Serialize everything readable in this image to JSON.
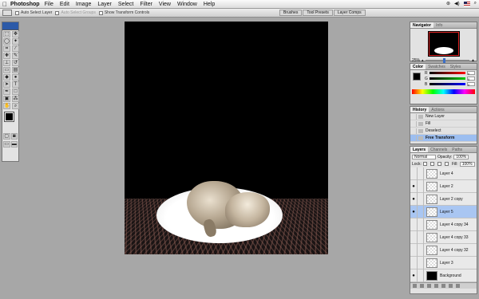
{
  "menubar": {
    "apple": "",
    "app_name": "Photoshop",
    "items": [
      "File",
      "Edit",
      "Image",
      "Layer",
      "Select",
      "Filter",
      "View",
      "Window",
      "Help"
    ]
  },
  "options": {
    "auto_select_layer": "Auto Select Layer",
    "auto_select_groups": "Auto Select Groups",
    "show_transform_controls": "Show Transform Controls",
    "well_tabs": [
      "Brushes",
      "Tool Presets",
      "Layer Comps"
    ]
  },
  "palettes": {
    "navigator": {
      "tabs": [
        "Navigator",
        "Info"
      ],
      "zoom": "25%"
    },
    "color": {
      "tabs": [
        "Color",
        "Swatches",
        "Styles"
      ],
      "channels": [
        {
          "label": "R",
          "value": "0"
        },
        {
          "label": "G",
          "value": "0"
        },
        {
          "label": "B",
          "value": "0"
        }
      ]
    },
    "history": {
      "tabs": [
        "History",
        "Actions"
      ],
      "items": [
        "New Layer",
        "Fill",
        "Deselect",
        "Free Transform"
      ]
    },
    "layers": {
      "tabs": [
        "Layers",
        "Channels",
        "Paths"
      ],
      "blend_mode": "Normal",
      "opacity_label": "Opacity:",
      "opacity": "100%",
      "lock_label": "Lock:",
      "fill_label": "Fill:",
      "fill": "100%",
      "rows": [
        "Layer 4",
        "Layer 2",
        "Layer 2 copy",
        "Layer 5",
        "Layer 4 copy 34",
        "Layer 4 copy 33",
        "Layer 4 copy 32",
        "Layer 3",
        "Background"
      ]
    }
  },
  "colors": {
    "app_bg": "#a7a7a7",
    "selection": "#a9c6f2",
    "foreground_swatch": "#000000",
    "background_swatch": "#ffffff"
  }
}
